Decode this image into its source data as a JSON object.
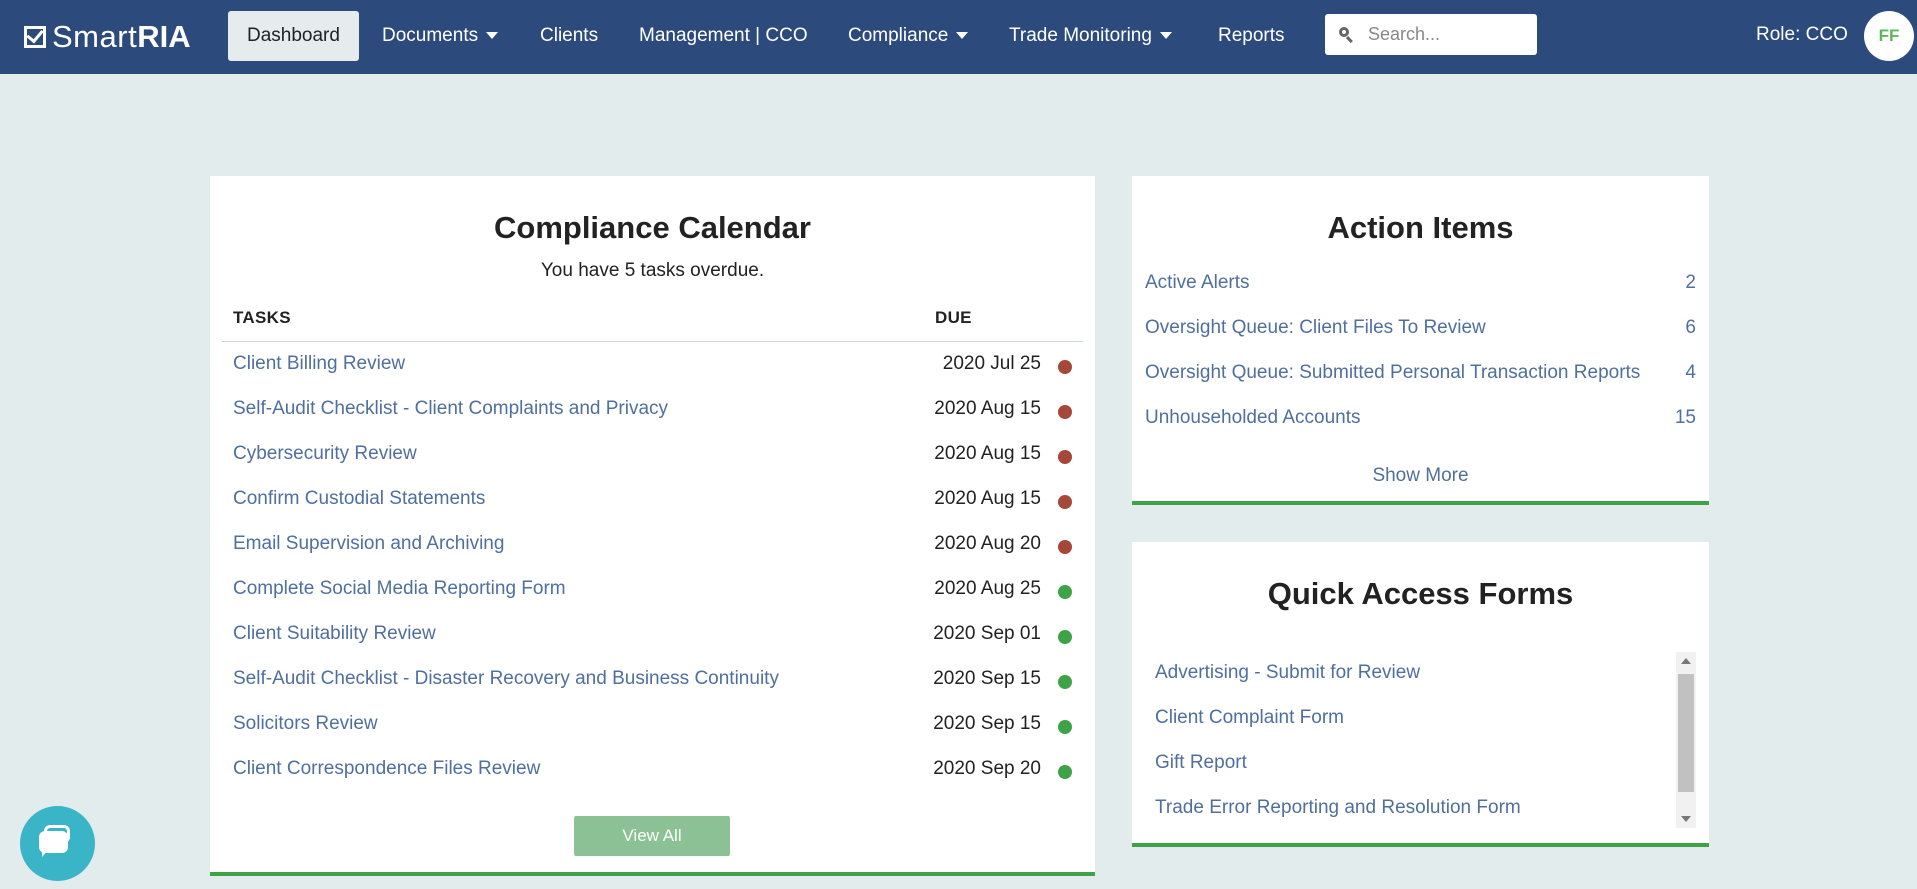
{
  "navbar": {
    "logo_smart": "Smart",
    "logo_ria": "RIA",
    "items": [
      {
        "label": "Dashboard"
      },
      {
        "label": "Documents"
      },
      {
        "label": "Clients"
      },
      {
        "label": "Management | CCO"
      },
      {
        "label": "Compliance"
      },
      {
        "label": "Trade Monitoring"
      },
      {
        "label": "Reports"
      }
    ],
    "search_placeholder": "Search...",
    "role": "Role: CCO",
    "avatar_initials": "FF"
  },
  "calendar": {
    "title": "Compliance Calendar",
    "subtitle": "You have 5 tasks overdue.",
    "col_tasks": "TASKS",
    "col_due": "DUE",
    "tasks": [
      {
        "name": "Client Billing Review",
        "due": "2020 Jul 25",
        "status": "overdue"
      },
      {
        "name": "Self-Audit Checklist - Client Complaints and Privacy",
        "due": "2020 Aug 15",
        "status": "overdue"
      },
      {
        "name": "Cybersecurity Review",
        "due": "2020 Aug 15",
        "status": "overdue"
      },
      {
        "name": "Confirm Custodial Statements",
        "due": "2020 Aug 15",
        "status": "overdue"
      },
      {
        "name": "Email Supervision and Archiving",
        "due": "2020 Aug 20",
        "status": "overdue"
      },
      {
        "name": "Complete Social Media Reporting Form",
        "due": "2020 Aug 25",
        "status": "upcoming"
      },
      {
        "name": "Client Suitability Review",
        "due": "2020 Sep 01",
        "status": "upcoming"
      },
      {
        "name": "Self-Audit Checklist - Disaster Recovery and Business Continuity",
        "due": "2020 Sep 15",
        "status": "upcoming"
      },
      {
        "name": "Solicitors Review",
        "due": "2020 Sep 15",
        "status": "upcoming"
      },
      {
        "name": "Client Correspondence Files Review",
        "due": "2020 Sep 20",
        "status": "upcoming"
      }
    ],
    "view_all": "View All"
  },
  "actions": {
    "title": "Action Items",
    "items": [
      {
        "label": "Active Alerts",
        "count": "2"
      },
      {
        "label": "Oversight Queue: Client Files To Review",
        "count": "6"
      },
      {
        "label": "Oversight Queue: Submitted Personal Transaction Reports",
        "count": "4"
      },
      {
        "label": "Unhouseholded Accounts",
        "count": "15"
      }
    ],
    "show_more": "Show More"
  },
  "forms": {
    "title": "Quick Access Forms",
    "items": [
      {
        "label": "Advertising - Submit for Review"
      },
      {
        "label": "Client Complaint Form"
      },
      {
        "label": "Gift Report"
      },
      {
        "label": "Trade Error Reporting and Resolution Form"
      }
    ]
  },
  "colors": {
    "navbar": "#2d4a7c",
    "overdue": "#a5483a",
    "upcoming": "#3ea346",
    "link": "#4f6f9f",
    "accent": "#3ea346"
  },
  "icons": {
    "logo": "checkbox-icon",
    "search": "search-icon",
    "caret": "chevron-down-icon",
    "chat": "chat-icon"
  }
}
